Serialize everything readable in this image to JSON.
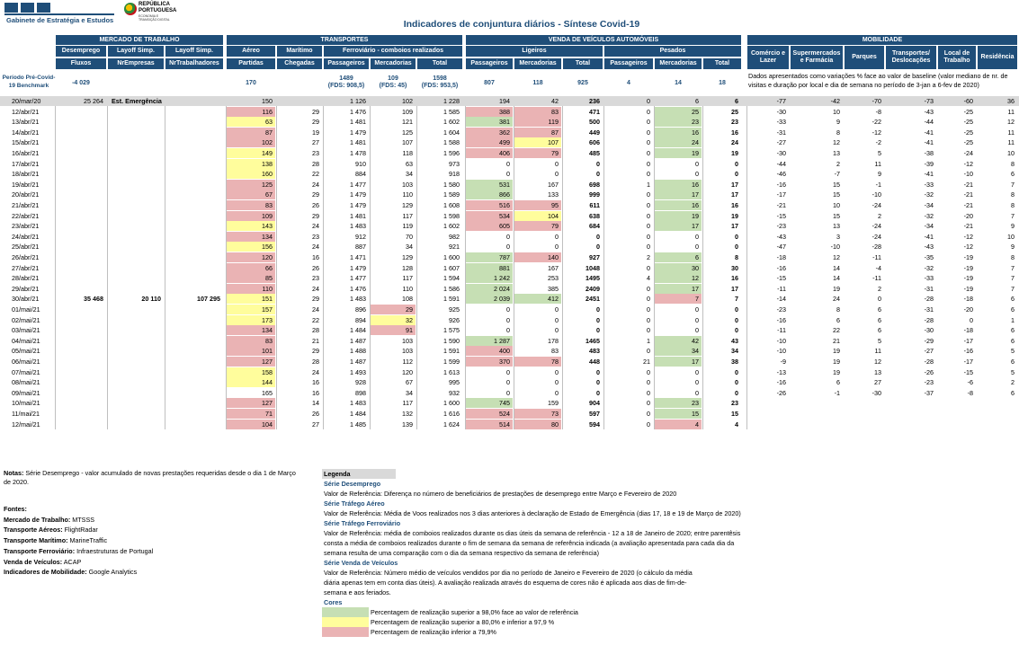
{
  "logo_gee": "Gabinete de Estratégia e Estudos",
  "logo_rep": "REPÚBLICA PORTUGUESA",
  "logo_rep_sub1": "ECONOMIA E",
  "logo_rep_sub2": "TRANSIÇÃO DIGITAL",
  "title": "Indicadores de conjuntura diários - Síntese Covid-19",
  "groups": {
    "mercado": "MERCADO DE TRABALHO",
    "transportes": "TRANSPORTES",
    "venda": "VENDA DE VEÍCULOS AUTOMÓVEIS",
    "mobilidade": "MOBILIDADE"
  },
  "sub": {
    "desemprego": "Desemprego",
    "layoff1": "Layoff Simp.",
    "layoff2": "Layoff Simp.",
    "aereo": "Aéreo",
    "maritimo": "Marítimo",
    "ferro": "Ferroviário - comboios realizados",
    "ligeiros": "Ligeiros",
    "pesados": "Pesados"
  },
  "cols": {
    "fluxos": "Fluxos",
    "nremp": "NrEmpresas",
    "nrtrab": "NrTrabalhadores",
    "partidas": "Partidas",
    "chegadas": "Chegadas",
    "passageiros": "Passageiros",
    "mercadorias": "Mercadorias",
    "total": "Total",
    "comercio": "Comércio e Lazer",
    "super": "Supermercados e Farmácia",
    "parques": "Parques",
    "transp": "Transportes/ Deslocações",
    "local": "Local de Trabalho",
    "resid": "Residência"
  },
  "bench_label": "Período Pré-Covid-19 Benchmark",
  "bench": {
    "desemp": "-4 029",
    "aereo": "170",
    "fp1": "1489",
    "fp2": "(FDS: 908,5)",
    "fm1": "109",
    "fm2": "(FDS: 45)",
    "ft1": "1598",
    "ft2": "(FDS: 953,5)",
    "lp": "807",
    "lm": "118",
    "lt": "925",
    "pp": "4",
    "pm": "14",
    "pt": "18"
  },
  "mob_note": "Dados apresentados como variações % face ao valor de baseline (valor mediano de nr. de visitas e duração por local e dia de semana no período de 3-jan a 6-fev de 2020)",
  "rows": [
    [
      "20/mar/20",
      "25 264",
      "Est. Emergência",
      "",
      "",
      "150",
      "",
      "1 126",
      "102",
      "1 228",
      "194",
      "42",
      "236",
      "0",
      "6",
      "6",
      "-77",
      "-42",
      "-70",
      "-73",
      "-60",
      "36"
    ],
    [
      "12/abr/21",
      "",
      "",
      "",
      "",
      "116",
      "29",
      "1 476",
      "109",
      "1 585",
      "388",
      "83",
      "471",
      "0",
      "25",
      "25",
      "-30",
      "10",
      "-8",
      "-43",
      "-25",
      "11"
    ],
    [
      "13/abr/21",
      "",
      "",
      "",
      "",
      "63",
      "29",
      "1 481",
      "121",
      "1 602",
      "381",
      "119",
      "500",
      "0",
      "23",
      "23",
      "-33",
      "9",
      "-22",
      "-44",
      "-25",
      "12"
    ],
    [
      "14/abr/21",
      "",
      "",
      "",
      "",
      "87",
      "19",
      "1 479",
      "125",
      "1 604",
      "362",
      "87",
      "449",
      "0",
      "16",
      "16",
      "-31",
      "8",
      "-12",
      "-41",
      "-25",
      "11"
    ],
    [
      "15/abr/21",
      "",
      "",
      "",
      "",
      "102",
      "27",
      "1 481",
      "107",
      "1 588",
      "499",
      "107",
      "606",
      "0",
      "24",
      "24",
      "-27",
      "12",
      "-2",
      "-41",
      "-25",
      "11"
    ],
    [
      "16/abr/21",
      "",
      "",
      "",
      "",
      "149",
      "23",
      "1 478",
      "118",
      "1 596",
      "406",
      "79",
      "485",
      "0",
      "19",
      "19",
      "-30",
      "13",
      "5",
      "-38",
      "-24",
      "10"
    ],
    [
      "17/abr/21",
      "",
      "",
      "",
      "",
      "138",
      "28",
      "910",
      "63",
      "973",
      "0",
      "0",
      "0",
      "0",
      "0",
      "0",
      "-44",
      "2",
      "11",
      "-39",
      "-12",
      "8"
    ],
    [
      "18/abr/21",
      "",
      "",
      "",
      "",
      "160",
      "22",
      "884",
      "34",
      "918",
      "0",
      "0",
      "0",
      "0",
      "0",
      "0",
      "-46",
      "-7",
      "9",
      "-41",
      "-10",
      "6"
    ],
    [
      "19/abr/21",
      "",
      "",
      "",
      "",
      "125",
      "24",
      "1 477",
      "103",
      "1 580",
      "531",
      "167",
      "698",
      "1",
      "16",
      "17",
      "-16",
      "15",
      "-1",
      "-33",
      "-21",
      "7"
    ],
    [
      "20/abr/21",
      "",
      "",
      "",
      "",
      "67",
      "29",
      "1 479",
      "110",
      "1 589",
      "866",
      "133",
      "999",
      "0",
      "17",
      "17",
      "-17",
      "15",
      "-10",
      "-32",
      "-21",
      "8"
    ],
    [
      "21/abr/21",
      "",
      "",
      "",
      "",
      "83",
      "26",
      "1 479",
      "129",
      "1 608",
      "516",
      "95",
      "611",
      "0",
      "16",
      "16",
      "-21",
      "10",
      "-24",
      "-34",
      "-21",
      "8"
    ],
    [
      "22/abr/21",
      "",
      "",
      "",
      "",
      "109",
      "29",
      "1 481",
      "117",
      "1 598",
      "534",
      "104",
      "638",
      "0",
      "19",
      "19",
      "-15",
      "15",
      "2",
      "-32",
      "-20",
      "7"
    ],
    [
      "23/abr/21",
      "",
      "",
      "",
      "",
      "143",
      "24",
      "1 483",
      "119",
      "1 602",
      "605",
      "79",
      "684",
      "0",
      "17",
      "17",
      "-23",
      "13",
      "-24",
      "-34",
      "-21",
      "9"
    ],
    [
      "24/abr/21",
      "",
      "",
      "",
      "",
      "134",
      "23",
      "912",
      "70",
      "982",
      "0",
      "0",
      "0",
      "0",
      "0",
      "0",
      "-43",
      "3",
      "-24",
      "-41",
      "-12",
      "10"
    ],
    [
      "25/abr/21",
      "",
      "",
      "",
      "",
      "156",
      "24",
      "887",
      "34",
      "921",
      "0",
      "0",
      "0",
      "0",
      "0",
      "0",
      "-47",
      "-10",
      "-28",
      "-43",
      "-12",
      "9"
    ],
    [
      "26/abr/21",
      "",
      "",
      "",
      "",
      "120",
      "16",
      "1 471",
      "129",
      "1 600",
      "787",
      "140",
      "927",
      "2",
      "6",
      "8",
      "-18",
      "12",
      "-11",
      "-35",
      "-19",
      "8"
    ],
    [
      "27/abr/21",
      "",
      "",
      "",
      "",
      "66",
      "26",
      "1 479",
      "128",
      "1 607",
      "881",
      "167",
      "1048",
      "0",
      "30",
      "30",
      "-16",
      "14",
      "-4",
      "-32",
      "-19",
      "7"
    ],
    [
      "28/abr/21",
      "",
      "",
      "",
      "",
      "85",
      "23",
      "1 477",
      "117",
      "1 594",
      "1 242",
      "253",
      "1495",
      "4",
      "12",
      "16",
      "-15",
      "14",
      "-11",
      "-33",
      "-19",
      "7"
    ],
    [
      "29/abr/21",
      "",
      "",
      "",
      "",
      "110",
      "24",
      "1 476",
      "110",
      "1 586",
      "2 024",
      "385",
      "2409",
      "0",
      "17",
      "17",
      "-11",
      "19",
      "2",
      "-31",
      "-19",
      "7"
    ],
    [
      "30/abr/21",
      "35 468",
      "20 110",
      "107 295",
      "",
      "151",
      "29",
      "1 483",
      "108",
      "1 591",
      "2 039",
      "412",
      "2451",
      "0",
      "7",
      "7",
      "-14",
      "24",
      "0",
      "-28",
      "-18",
      "6"
    ],
    [
      "01/mai/21",
      "",
      "",
      "",
      "",
      "157",
      "24",
      "896",
      "29",
      "925",
      "0",
      "0",
      "0",
      "0",
      "0",
      "0",
      "-23",
      "8",
      "6",
      "-31",
      "-20",
      "6"
    ],
    [
      "02/mai/21",
      "",
      "",
      "",
      "",
      "173",
      "22",
      "894",
      "32",
      "926",
      "0",
      "0",
      "0",
      "0",
      "0",
      "0",
      "-16",
      "6",
      "6",
      "-28",
      "0",
      "1"
    ],
    [
      "03/mai/21",
      "",
      "",
      "",
      "",
      "134",
      "28",
      "1 484",
      "91",
      "1 575",
      "0",
      "0",
      "0",
      "0",
      "0",
      "0",
      "-11",
      "22",
      "6",
      "-30",
      "-18",
      "6"
    ],
    [
      "04/mai/21",
      "",
      "",
      "",
      "",
      "83",
      "21",
      "1 487",
      "103",
      "1 590",
      "1 287",
      "178",
      "1465",
      "1",
      "42",
      "43",
      "-10",
      "21",
      "5",
      "-29",
      "-17",
      "6"
    ],
    [
      "05/mai/21",
      "",
      "",
      "",
      "",
      "101",
      "29",
      "1 488",
      "103",
      "1 591",
      "400",
      "83",
      "483",
      "0",
      "34",
      "34",
      "-10",
      "19",
      "11",
      "-27",
      "-16",
      "5"
    ],
    [
      "06/mai/21",
      "",
      "",
      "",
      "",
      "127",
      "28",
      "1 487",
      "112",
      "1 599",
      "370",
      "78",
      "448",
      "21",
      "17",
      "38",
      "-9",
      "19",
      "12",
      "-28",
      "-17",
      "6"
    ],
    [
      "07/mai/21",
      "",
      "",
      "",
      "",
      "158",
      "24",
      "1 493",
      "120",
      "1 613",
      "0",
      "0",
      "0",
      "0",
      "0",
      "0",
      "-13",
      "19",
      "13",
      "-26",
      "-15",
      "5"
    ],
    [
      "08/mai/21",
      "",
      "",
      "",
      "",
      "144",
      "16",
      "928",
      "67",
      "995",
      "0",
      "0",
      "0",
      "0",
      "0",
      "0",
      "-16",
      "6",
      "27",
      "-23",
      "-6",
      "2"
    ],
    [
      "09/mai/21",
      "",
      "",
      "",
      "",
      "165",
      "16",
      "898",
      "34",
      "932",
      "0",
      "0",
      "0",
      "0",
      "0",
      "0",
      "-26",
      "-1",
      "-30",
      "-37",
      "-8",
      "6"
    ],
    [
      "10/mai/21",
      "",
      "",
      "",
      "",
      "127",
      "14",
      "1 483",
      "117",
      "1 600",
      "745",
      "159",
      "904",
      "0",
      "23",
      "23",
      "",
      "",
      "",
      "",
      "",
      ""
    ],
    [
      "11/mai/21",
      "",
      "",
      "",
      "",
      "71",
      "26",
      "1 484",
      "132",
      "1 616",
      "524",
      "73",
      "597",
      "0",
      "15",
      "15",
      "",
      "",
      "",
      "",
      "",
      ""
    ],
    [
      "12/mai/21",
      "",
      "",
      "",
      "",
      "104",
      "27",
      "1 485",
      "139",
      "1 624",
      "514",
      "80",
      "594",
      "0",
      "4",
      "4",
      "",
      "",
      "",
      "",
      "",
      ""
    ]
  ],
  "colors": {
    "green": "#c6dfb4",
    "yellow": "#fffd9c",
    "pink": "#eab3b4",
    "navy": "#1f4e79"
  },
  "row_colors": [
    "",
    "PNNPP",
    "YNNGP",
    "PNNPP",
    "PNNPY",
    "YNNPP",
    "YNNNN",
    "YNNNN",
    "PNNGN",
    "PNNGN",
    "PNNPP",
    "PNNPY",
    "YNNPP",
    "PNNNN",
    "YNNNN",
    "PNNGP",
    "PNNGN",
    "PNNGN",
    "PNNGN",
    "YNNGG",
    "YNPNN",
    "YNYNN",
    "PNPNN",
    "PNNGN",
    "PNNPN",
    "PNNPP",
    "YNNNN",
    "YNNNN",
    "NNNNN",
    "PNNGN",
    "PNNPP",
    "PNNPP"
  ],
  "pes_colors": [
    "",
    "G",
    "G",
    "G",
    "G",
    "G",
    "N",
    "N",
    "G",
    "G",
    "G",
    "G",
    "G",
    "N",
    "N",
    "G",
    "G",
    "G",
    "G",
    "P",
    "N",
    "N",
    "N",
    "G",
    "G",
    "G",
    "N",
    "N",
    "N",
    "G",
    "G",
    "P"
  ],
  "notes": {
    "label": "Notas:",
    "text": "Série Desemprego - valor acumulado de novas prestações requeridas desde o dia 1 de Março de 2020."
  },
  "sources": {
    "title": "Fontes:",
    "items": [
      [
        "Mercado de Trabalho:",
        "MTSSS"
      ],
      [
        "Transporte Aéreos:",
        "FlightRadar"
      ],
      [
        "Transporte Marítimo:",
        "MarineTraffic"
      ],
      [
        "Transporte Ferroviário:",
        "Infraestruturas de Portugal"
      ],
      [
        "Venda de Veículos:",
        "ACAP"
      ],
      [
        "Indicadores de Mobilidade:",
        "Google Analytics"
      ]
    ]
  },
  "legend": {
    "title": "Legenda",
    "s1": "Série Desemprego",
    "p1": "Valor de Referência: Diferença no número de beneficiários de prestações de desemprego entre Março e Fevereiro de 2020",
    "s2": "Série Tráfego Aéreo",
    "p2": "Valor de Referência: Média de Voos realizados nos 3 dias anteriores à declaração de Estado de Emergência (dias 17, 18 e 19 de Março de 2020)",
    "s3": "Série Tráfego Ferroviário",
    "p3a": "Valor de Referência: média de comboios realizados durante os dias úteis da semana de referência - 12 a 18 de Janeiro de 2020; entre parentêsis",
    "p3b": "consta a média de comboios realizados durante o fim de semana da semana de referência indicada (a avaliação apresentada para cada dia da",
    "p3c": "semana resulta de uma comparação com o dia da semana respectivo da semana de referência)",
    "s4": "Série Venda de Veículos",
    "p4a": "Valor de Referência: Número médio de veículos vendidos por dia no período de Janeiro e Fevereiro de 2020 (o cálculo da média",
    "p4b": "diária apenas tem em conta dias úteis). A avaliação realizada através do esquema de cores não é aplicada aos dias de fim-de-",
    "p4c": "semana e aos feriados.",
    "cores": "Cores",
    "c1": "Percentagem de realização superior a 98,0% face ao valor de referência",
    "c2": "Percentagem de realização superior a 80,0% e inferior a 97,9 %",
    "c3": "Percentagem de realização inferior a 79,9%"
  }
}
